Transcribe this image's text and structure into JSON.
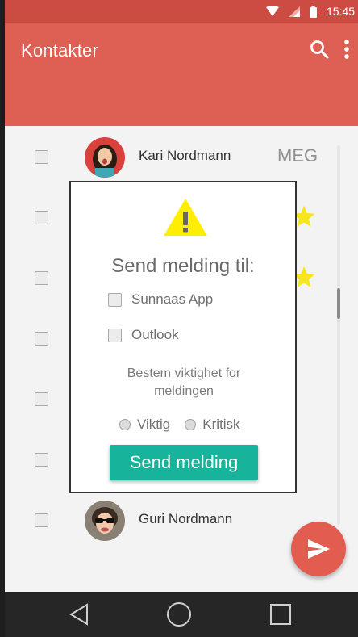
{
  "status_bar": {
    "time": "15:45"
  },
  "app_bar": {
    "title": "Kontakter"
  },
  "contacts": [
    {
      "name": "Kari Nordmann",
      "tag": "MEG"
    },
    {
      "name": "Guri Nordmann"
    }
  ],
  "dialog": {
    "title": "Send melding til:",
    "options": [
      "Sunnaas App",
      "Outlook"
    ],
    "importance_label": "Bestem viktighet for meldingen",
    "radios": [
      "Viktig",
      "Kritisk"
    ],
    "send_label": "Send melding"
  },
  "colors": {
    "primary": "#de5f53",
    "primary_dark": "#cc4c43",
    "accent": "#17b39b",
    "star": "#f7e51d",
    "warning": "#ffee00"
  }
}
